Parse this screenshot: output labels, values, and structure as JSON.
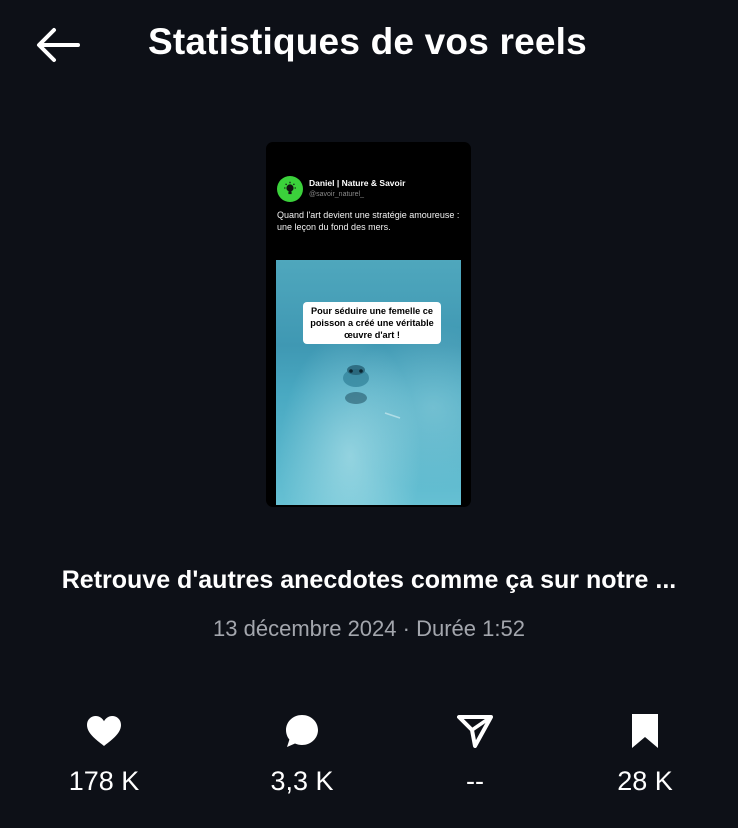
{
  "header": {
    "title": "Statistiques de vos reels",
    "back_icon": "arrow-left-icon"
  },
  "reel": {
    "thumbnail": {
      "account_name": "Daniel | Nature & Savoir",
      "account_handle": "@savoir_naturel_",
      "caption": "Quand l'art devient une stratégie amoureuse : une leçon du fond des mers.",
      "video_overlay_text": "Pour séduire une femelle ce poisson a créé une véritable œuvre d'art !",
      "avatar_icon": "lightbulb-icon",
      "avatar_color": "#3bd13b"
    },
    "caption": "Retrouve d'autres anecdotes comme ça sur notre ...",
    "date": "13 décembre 2024",
    "separator": " · ",
    "duration": "Durée 1:52"
  },
  "stats": {
    "likes": {
      "icon": "heart-icon",
      "value": "178 K"
    },
    "comments": {
      "icon": "comment-icon",
      "value": "3,3 K"
    },
    "shares": {
      "icon": "send-icon",
      "value": "--"
    },
    "saves": {
      "icon": "bookmark-icon",
      "value": "28 K"
    }
  },
  "colors": {
    "background": "#0d1017",
    "text": "#ffffff",
    "muted_text": "#a3a6ad"
  }
}
